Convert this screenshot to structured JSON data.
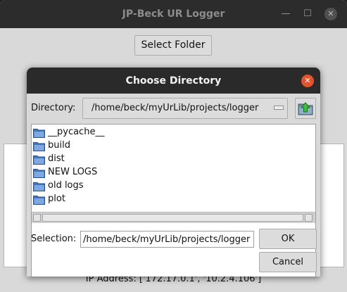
{
  "main_window": {
    "title": "JP-Beck UR Logger",
    "minimize_glyph": "—",
    "maximize_glyph": "☐",
    "close_glyph": "✕",
    "select_folder_label": "Select Folder",
    "ip_address_text": "IP Address: ['172.17.0.1', '10.2.4.106']"
  },
  "dialog": {
    "title": "Choose Directory",
    "close_glyph": "✕",
    "directory_label": "Directory:",
    "directory_value": "/home/beck/myUrLib/projects/logger",
    "files": [
      {
        "name": "__pycache__",
        "icon": "folder-icon"
      },
      {
        "name": "build",
        "icon": "folder-icon"
      },
      {
        "name": "dist",
        "icon": "folder-icon"
      },
      {
        "name": "NEW LOGS",
        "icon": "folder-icon"
      },
      {
        "name": "old logs",
        "icon": "folder-icon"
      },
      {
        "name": "plot",
        "icon": "folder-icon"
      }
    ],
    "selection_label": "Selection:",
    "selection_value": "/home/beck/myUrLib/projects/logger",
    "ok_label": "OK",
    "cancel_label": "Cancel"
  },
  "colors": {
    "titlebar": "#2c2c2c",
    "window_bg": "#d9d9d9",
    "dialog_close": "#e3542d",
    "folder_blue": "#5a8fd6"
  }
}
